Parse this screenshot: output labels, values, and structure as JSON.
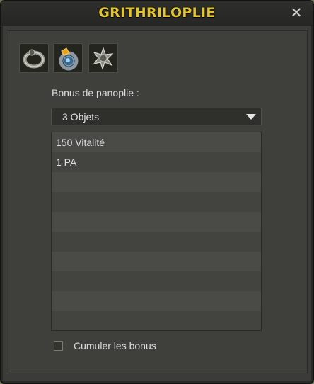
{
  "window": {
    "title": "GRITHRILOPLIE",
    "close_icon": "close-icon"
  },
  "items": [
    {
      "icon": "ring-item-icon"
    },
    {
      "icon": "amulet-item-icon"
    },
    {
      "icon": "shield-item-icon"
    }
  ],
  "bonus": {
    "label": "Bonus de panoplie :",
    "selected": "3 Objets",
    "rows": [
      "150 Vitalité",
      "1 PA",
      "",
      "",
      "",
      "",
      "",
      "",
      "",
      ""
    ]
  },
  "cumul": {
    "label": "Cumuler les bonus",
    "checked": false
  },
  "colors": {
    "title": "#e2c531",
    "background": "#3b3b37"
  }
}
